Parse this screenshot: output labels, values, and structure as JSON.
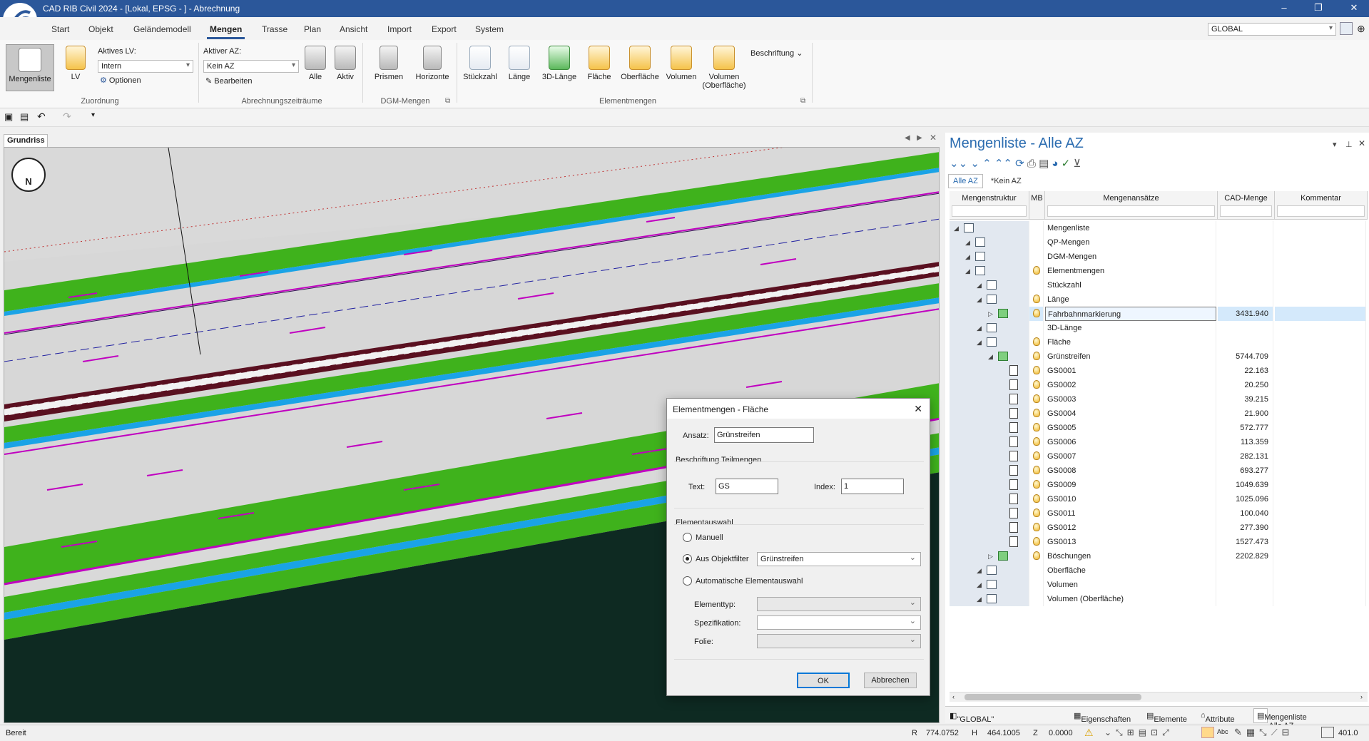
{
  "app": {
    "title": "CAD RIB Civil 2024 - [Lokal, EPSG - ] - Abrechnung",
    "minimize": "–",
    "restore": "❐",
    "close": "✕"
  },
  "menu": [
    "Start",
    "Objekt",
    "Geländemodell",
    "Mengen",
    "Trasse",
    "Plan",
    "Ansicht",
    "Import",
    "Export",
    "System"
  ],
  "global_combo": "GLOBAL",
  "ribbon": {
    "mengenliste": "Mengenliste",
    "lv": "LV",
    "aktives_lv_label": "Aktives LV:",
    "aktives_lv_value": "Intern",
    "optionen": "Optionen",
    "zuordnung": "Zuordnung",
    "aktiver_az_label": "Aktiver AZ:",
    "aktiver_az_value": "Kein AZ",
    "bearbeiten": "Bearbeiten",
    "alle": "Alle",
    "aktiv": "Aktiv",
    "abrechnungszeitraeume": "Abrechnungszeiträume",
    "prismen": "Prismen",
    "horizonte": "Horizonte",
    "dgm_mengen": "DGM-Mengen",
    "stueckzahl": "Stückzahl",
    "laenge": "Länge",
    "laenge3d": "3D-Länge",
    "flaeche": "Fläche",
    "oberflaeche": "Oberfläche",
    "volumen": "Volumen",
    "volumen_ob1": "Volumen",
    "volumen_ob2": "(Oberfläche)",
    "elementmengen": "Elementmengen",
    "beschriftung": "Beschriftung"
  },
  "view": {
    "tab": "Grundriss",
    "compass": "N"
  },
  "panel": {
    "title": "Mengenliste - Alle AZ",
    "tabs": [
      "Alle AZ",
      "*Kein AZ"
    ],
    "headers": {
      "struktur": "Mengenstruktur",
      "mb": "MB",
      "ansaetze": "Mengenansätze",
      "cad": "CAD-Menge",
      "kommentar": "Kommentar"
    },
    "rows": [
      {
        "name": "Mengenliste",
        "qty": "",
        "bulb": false,
        "indent": 0,
        "icon": "node"
      },
      {
        "name": "QP-Mengen",
        "qty": "",
        "bulb": false,
        "indent": 1,
        "icon": "node"
      },
      {
        "name": "DGM-Mengen",
        "qty": "",
        "bulb": false,
        "indent": 1,
        "icon": "node"
      },
      {
        "name": "Elementmengen",
        "qty": "",
        "bulb": true,
        "indent": 1,
        "icon": "node"
      },
      {
        "name": "Stückzahl",
        "qty": "",
        "bulb": false,
        "indent": 2,
        "icon": "node"
      },
      {
        "name": "Länge",
        "qty": "",
        "bulb": true,
        "indent": 2,
        "icon": "node"
      },
      {
        "name": "Fahrbahnmarkierung",
        "qty": "3431.940",
        "bulb": true,
        "indent": 3,
        "icon": "green",
        "selected": true
      },
      {
        "name": "3D-Länge",
        "qty": "",
        "bulb": false,
        "indent": 2,
        "icon": "node"
      },
      {
        "name": "Fläche",
        "qty": "",
        "bulb": true,
        "indent": 2,
        "icon": "node"
      },
      {
        "name": "Grünstreifen",
        "qty": "5744.709",
        "bulb": true,
        "indent": 3,
        "icon": "green"
      },
      {
        "name": "GS0001",
        "qty": "22.163",
        "bulb": true,
        "indent": 4,
        "icon": "doc"
      },
      {
        "name": "GS0002",
        "qty": "20.250",
        "bulb": true,
        "indent": 4,
        "icon": "doc"
      },
      {
        "name": "GS0003",
        "qty": "39.215",
        "bulb": true,
        "indent": 4,
        "icon": "doc"
      },
      {
        "name": "GS0004",
        "qty": "21.900",
        "bulb": true,
        "indent": 4,
        "icon": "doc"
      },
      {
        "name": "GS0005",
        "qty": "572.777",
        "bulb": true,
        "indent": 4,
        "icon": "doc"
      },
      {
        "name": "GS0006",
        "qty": "113.359",
        "bulb": true,
        "indent": 4,
        "icon": "doc"
      },
      {
        "name": "GS0007",
        "qty": "282.131",
        "bulb": true,
        "indent": 4,
        "icon": "doc"
      },
      {
        "name": "GS0008",
        "qty": "693.277",
        "bulb": true,
        "indent": 4,
        "icon": "doc"
      },
      {
        "name": "GS0009",
        "qty": "1049.639",
        "bulb": true,
        "indent": 4,
        "icon": "doc"
      },
      {
        "name": "GS0010",
        "qty": "1025.096",
        "bulb": true,
        "indent": 4,
        "icon": "doc"
      },
      {
        "name": "GS0011",
        "qty": "100.040",
        "bulb": true,
        "indent": 4,
        "icon": "doc"
      },
      {
        "name": "GS0012",
        "qty": "277.390",
        "bulb": true,
        "indent": 4,
        "icon": "doc"
      },
      {
        "name": "GS0013",
        "qty": "1527.473",
        "bulb": true,
        "indent": 4,
        "icon": "doc"
      },
      {
        "name": "Böschungen",
        "qty": "2202.829",
        "bulb": true,
        "indent": 3,
        "icon": "green"
      },
      {
        "name": "Oberfläche",
        "qty": "",
        "bulb": false,
        "indent": 2,
        "icon": "node"
      },
      {
        "name": "Volumen",
        "qty": "",
        "bulb": false,
        "indent": 2,
        "icon": "node"
      },
      {
        "name": "Volumen (Oberfläche)",
        "qty": "",
        "bulb": false,
        "indent": 2,
        "icon": "node"
      }
    ],
    "footer": [
      "\"GLOBAL\" Folienverwaltung",
      "Eigenschaften",
      "Elemente",
      "Attribute",
      "Mengenliste - Alle AZ"
    ]
  },
  "dialog": {
    "title": "Elementmengen - Fläche",
    "ansatz_label": "Ansatz:",
    "ansatz_value": "Grünstreifen",
    "beschriftung_label": "Beschriftung Teilmengen",
    "text_label": "Text:",
    "text_value": "GS",
    "index_label": "Index:",
    "index_value": "1",
    "elementauswahl": "Elementauswahl",
    "manuell": "Manuell",
    "aus_objektfilter": "Aus Objektfilter",
    "objektfilter_value": "Grünstreifen",
    "automatisch": "Automatische Elementauswahl",
    "elementtyp": "Elementtyp:",
    "spezifikation": "Spezifikation:",
    "folie": "Folie:",
    "ok": "OK",
    "abbrechen": "Abbrechen"
  },
  "status": {
    "state": "Bereit",
    "r_label": "R",
    "r_value": "774.0752",
    "h_label": "H",
    "h_value": "464.1005",
    "z_label": "Z",
    "z_value": "0.0000",
    "zoom": "401.0"
  },
  "colors": {
    "accent": "#2b579a",
    "green": "#3fb21c",
    "blue": "#1aa3e6",
    "magenta": "#c000c0",
    "road": "#d7d7d7",
    "dark": "#0e2a22"
  }
}
